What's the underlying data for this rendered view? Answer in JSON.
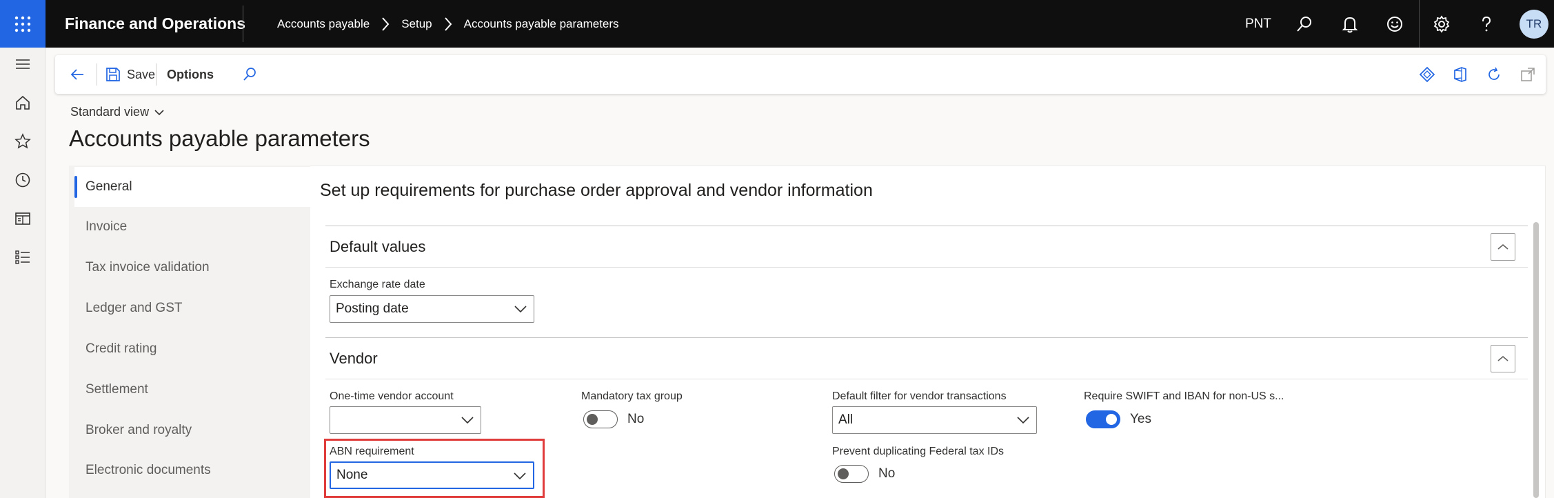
{
  "topbar": {
    "app_name": "Finance and Operations",
    "breadcrumbs": [
      "Accounts payable",
      "Setup",
      "Accounts payable parameters"
    ],
    "company": "PNT",
    "user_initials": "TR"
  },
  "action_pane": {
    "save_label": "Save",
    "options_label": "Options"
  },
  "page": {
    "view_selector": "Standard view",
    "title": "Accounts payable parameters",
    "section_heading": "Set up requirements for purchase order approval and vendor information"
  },
  "tabs": [
    {
      "label": "General",
      "active": true
    },
    {
      "label": "Invoice",
      "active": false
    },
    {
      "label": "Tax invoice validation",
      "active": false
    },
    {
      "label": "Ledger and GST",
      "active": false
    },
    {
      "label": "Credit rating",
      "active": false
    },
    {
      "label": "Settlement",
      "active": false
    },
    {
      "label": "Broker and royalty",
      "active": false
    },
    {
      "label": "Electronic documents",
      "active": false
    }
  ],
  "default_values": {
    "title": "Default values",
    "exchange_rate_date": {
      "label": "Exchange rate date",
      "value": "Posting date"
    }
  },
  "vendor": {
    "title": "Vendor",
    "one_time_vendor_account": {
      "label": "One-time vendor account",
      "value": ""
    },
    "mandatory_tax_group": {
      "label": "Mandatory tax group",
      "value": "No",
      "on": false
    },
    "default_filter": {
      "label": "Default filter for vendor transactions",
      "value": "All"
    },
    "require_swift_iban": {
      "label": "Require SWIFT and IBAN for non-US s...",
      "value": "Yes",
      "on": true
    },
    "abn_requirement": {
      "label": "ABN requirement",
      "value": "None"
    },
    "prevent_duplicating": {
      "label": "Prevent duplicating Federal tax IDs",
      "value": "No",
      "on": false
    }
  },
  "colors": {
    "accent": "#2266e3",
    "topbar": "#0f0f0f",
    "highlight": "#e03c3c"
  }
}
